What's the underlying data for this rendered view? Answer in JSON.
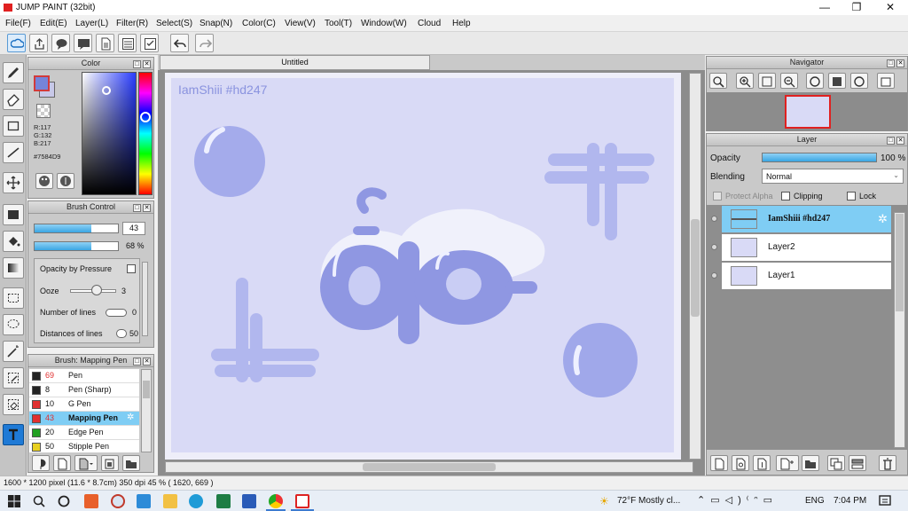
{
  "window": {
    "title": "JUMP PAINT (32bit)",
    "min": "—",
    "max": "❐",
    "close": "✕"
  },
  "menu": [
    "File(F)",
    "Edit(E)",
    "Layer(L)",
    "Filter(R)",
    "Select(S)",
    "Snap(N)",
    "Color(C)",
    "View(V)",
    "Tool(T)",
    "Window(W)",
    "Cloud",
    "Help"
  ],
  "color_panel": {
    "title": "Color",
    "r": "R:117",
    "g": "G:132",
    "b": "B:217",
    "hex": "#7584D9",
    "main_color": "#7584D9"
  },
  "brush_control": {
    "title": "Brush Control",
    "size_value": "43",
    "size_fraction": 0.68,
    "opacity_value": "68 %",
    "opacity_fraction": 0.68,
    "opacity_by_pressure": "Opacity by Pressure",
    "ooze": "Ooze",
    "ooze_value": "3",
    "number_of_lines": "Number of lines",
    "number_of_lines_value": "0",
    "distances_of_lines": "Distances of lines",
    "distances_value": "50"
  },
  "brush_list": {
    "title": "Brush: Mapping Pen",
    "items": [
      {
        "size": "69",
        "name": "Pen",
        "color": "#222222"
      },
      {
        "size": "8",
        "name": "Pen (Sharp)",
        "color": "#222222"
      },
      {
        "size": "10",
        "name": "G Pen",
        "color": "#e03030"
      },
      {
        "size": "43",
        "name": "Mapping Pen",
        "color": "#e03030",
        "selected": true
      },
      {
        "size": "20",
        "name": "Edge Pen",
        "color": "#22a022"
      },
      {
        "size": "50",
        "name": "Stipple Pen",
        "color": "#e8d020"
      }
    ]
  },
  "document": {
    "tab": "Untitled",
    "watermark": "IamShiii #hd247"
  },
  "navigator": {
    "title": "Navigator"
  },
  "layer_panel": {
    "title": "Layer",
    "opacity_label": "Opacity",
    "opacity_value": "100 %",
    "opacity_fraction": 1.0,
    "blending_label": "Blending",
    "blending_value": "Normal",
    "protect_alpha": "Protect Alpha",
    "clipping": "Clipping",
    "lock": "Lock",
    "layers": [
      {
        "name": "IamShiii #hd247",
        "selected": true
      },
      {
        "name": "Layer2",
        "selected": false
      },
      {
        "name": "Layer1",
        "selected": false
      }
    ]
  },
  "status": {
    "text": "1600 * 1200 pixel   (11.6 * 8.7cm)   350 dpi   45 %   ( 1620, 669 )"
  },
  "taskbar": {
    "weather": "72°F  Mostly cl...",
    "lang": "ENG",
    "time": "7:04 PM"
  }
}
